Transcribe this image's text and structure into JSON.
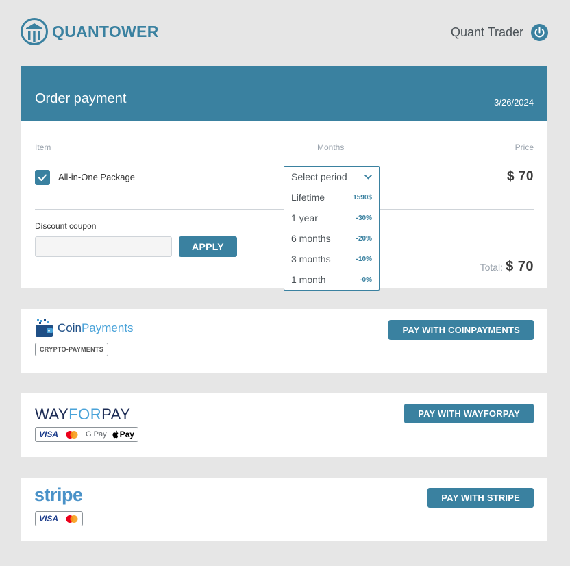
{
  "header": {
    "brand": "QUANTOWER",
    "user_name": "Quant Trader"
  },
  "order": {
    "title": "Order payment",
    "date": "3/26/2024",
    "columns": {
      "item": "Item",
      "months": "Months",
      "price": "Price"
    },
    "item_name": "All-in-One Package",
    "item_checked": true,
    "item_price": "$ 70",
    "coupon_label": "Discount coupon",
    "coupon_value": "",
    "apply_label": "APPLY",
    "total_label": "Total:",
    "total_value": "$ 70"
  },
  "period_dropdown": {
    "placeholder": "Select period",
    "options": [
      {
        "label": "Lifetime",
        "badge": "1590$"
      },
      {
        "label": "1 year",
        "badge": "-30%"
      },
      {
        "label": "6 months",
        "badge": "-20%"
      },
      {
        "label": "3 months",
        "badge": "-10%"
      },
      {
        "label": "1 month",
        "badge": "-0%"
      }
    ]
  },
  "payments": {
    "coinpayments": {
      "logo_part1": "Coin",
      "logo_part2": "Payments",
      "badge": "CRYPTO-PAYMENTS",
      "button": "PAY WITH COINPAYMENTS"
    },
    "wayforpay": {
      "logo_part1": "WAY",
      "logo_part2": "FOR",
      "logo_part3": "PAY",
      "visa": "VISA",
      "gpay": "G Pay",
      "apay": "Pay",
      "button": "PAY WITH WAYFORPAY"
    },
    "stripe": {
      "logo": "stripe",
      "visa": "VISA",
      "button": "PAY WITH STRIPE"
    }
  },
  "colors": {
    "accent": "#3a81a0",
    "background": "#e6e6e6",
    "card": "#ffffff"
  }
}
